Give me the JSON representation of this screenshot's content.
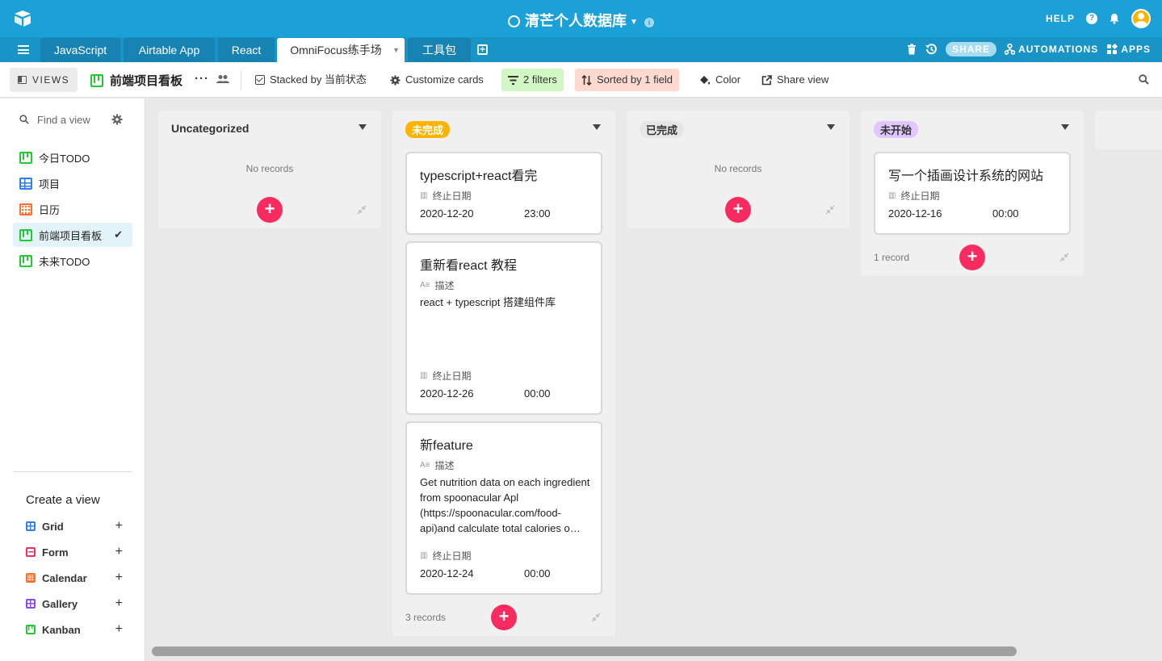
{
  "header": {
    "base_title": "清芒个人数据库",
    "help_label": "HELP",
    "help_q": "?",
    "info_glyph": "i"
  },
  "tabs": [
    {
      "label": "JavaScript"
    },
    {
      "label": "Airtable App"
    },
    {
      "label": "React"
    },
    {
      "label": "OmniFocus练手场"
    },
    {
      "label": "工具包"
    }
  ],
  "tab_actions": {
    "share_label": "SHARE",
    "automations_label": "AUTOMATIONS",
    "apps_label": "APPS"
  },
  "viewbar": {
    "views_label": "VIEWS",
    "current_view_name": "前端项目看板",
    "stacked_label": "Stacked by 当前状态",
    "customize_label": "Customize cards",
    "filters_label": "2 filters",
    "sorted_label": "Sorted by 1 field",
    "color_label": "Color",
    "share_view_label": "Share view"
  },
  "sidebar": {
    "find_placeholder": "Find a view",
    "views": [
      {
        "label": "今日TODO",
        "type": "kanban"
      },
      {
        "label": "项目",
        "type": "grid"
      },
      {
        "label": "日历",
        "type": "calendar"
      },
      {
        "label": "前端项目看板",
        "type": "kanban",
        "active": true
      },
      {
        "label": "未来TODO",
        "type": "kanban"
      }
    ],
    "create_title": "Create a view",
    "create_items": [
      {
        "label": "Grid",
        "color": "#2d7ff9"
      },
      {
        "label": "Form",
        "color": "#f82b60"
      },
      {
        "label": "Calendar",
        "color": "#ff6f2c"
      },
      {
        "label": "Gallery",
        "color": "#8b46ff"
      },
      {
        "label": "Kanban",
        "color": "#20c933"
      }
    ]
  },
  "board": {
    "stacks": [
      {
        "title": "Uncategorized",
        "pill_color": null,
        "empty_label": "No records",
        "cards": []
      },
      {
        "title": "未完成",
        "pill_color": "#fcb400",
        "record_count": "3 records",
        "cards": [
          {
            "title": "typescript+react看完",
            "date_label": "终止日期",
            "date": "2020-12-20",
            "time": "23:00"
          },
          {
            "title": "重新看react 教程",
            "desc_label": "描述",
            "desc": "react + typescript 搭建组件库",
            "date_label": "终止日期",
            "date": "2020-12-26",
            "time": "00:00"
          },
          {
            "title": "新feature",
            "desc_label": "描述",
            "desc": "Get nutrition data on each ingredient from spoonacular Apl (https://spoonacular.com/food-api)and calculate total calories o…",
            "date_label": "终止日期",
            "date": "2020-12-24",
            "time": "00:00"
          }
        ]
      },
      {
        "title": "已完成",
        "pill_color": "#eeeeee",
        "empty_label": "No records",
        "cards": []
      },
      {
        "title": "未开始",
        "pill_color": "#e4c9ff",
        "record_count": "1 record",
        "cards": [
          {
            "title": "写一个插画设计系统的网站",
            "date_label": "终止日期",
            "date": "2020-12-16",
            "time": "00:00"
          }
        ]
      }
    ]
  },
  "colors": {
    "topbar": "#1ba1d8",
    "add_button": "#f82b60",
    "filters_bg": "#d1f7c4",
    "sorted_bg": "#fdd9d0"
  }
}
